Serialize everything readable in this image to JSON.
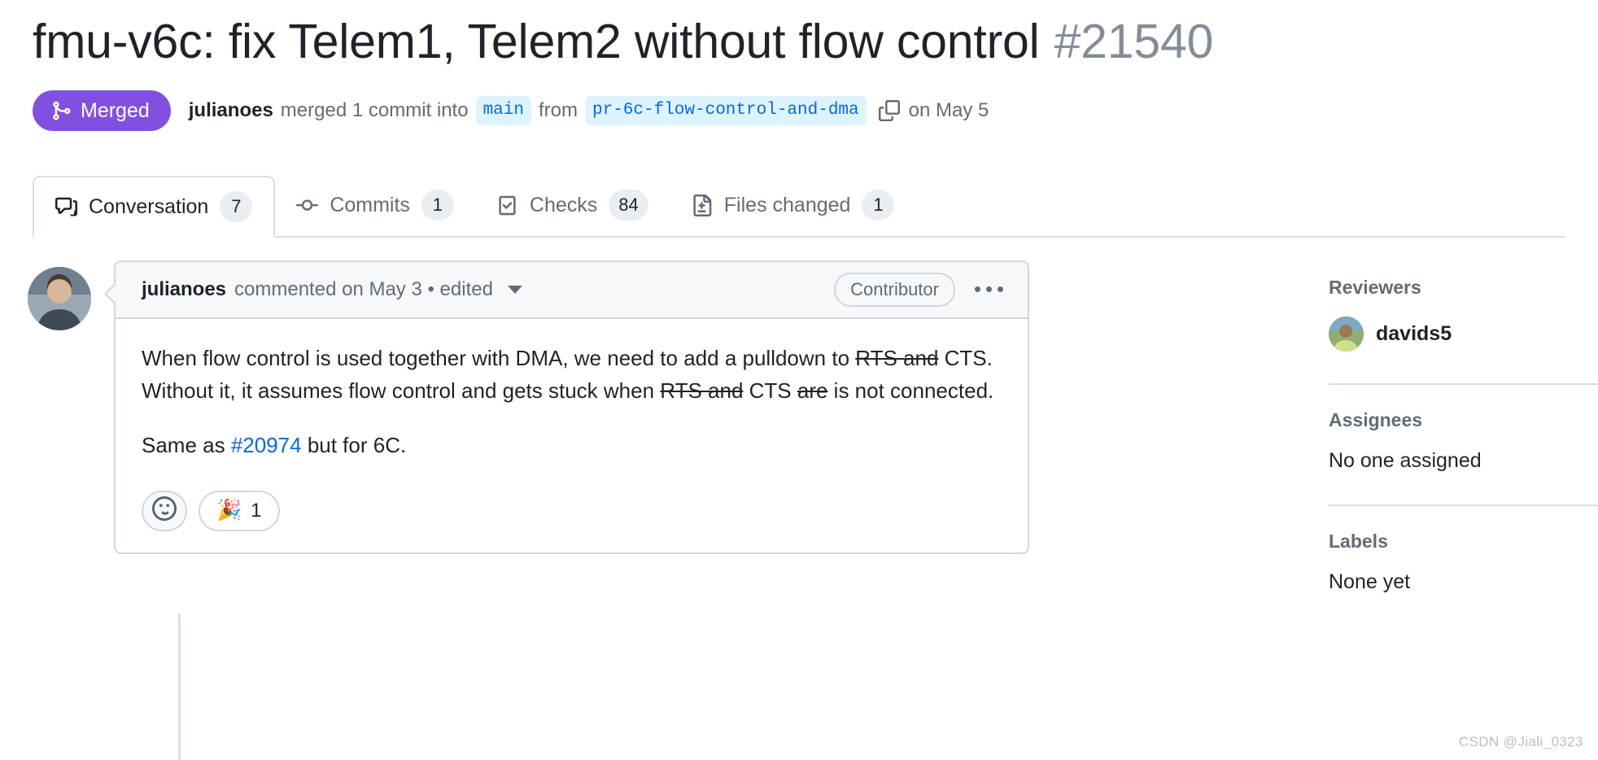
{
  "header": {
    "title": "fmu-v6c: fix Telem1, Telem2 without flow control",
    "number": "#21540",
    "state_label": "Merged",
    "state_color": "#8250df",
    "actor": "julianoes",
    "merged_text": "merged 1 commit into",
    "base_branch": "main",
    "from_text": "from",
    "head_branch": "pr-6c-flow-control-and-dma",
    "merged_date": "on May 5",
    "copy_icon": "copy-icon",
    "merge_icon": "git-merge-icon"
  },
  "tabs": [
    {
      "label": "Conversation",
      "count": "7",
      "icon": "comment-discussion-icon",
      "active": true
    },
    {
      "label": "Commits",
      "count": "1",
      "icon": "git-commit-icon",
      "active": false
    },
    {
      "label": "Checks",
      "count": "84",
      "icon": "checklist-icon",
      "active": false
    },
    {
      "label": "Files changed",
      "count": "1",
      "icon": "file-diff-icon",
      "active": false
    }
  ],
  "comment": {
    "author": "julianoes",
    "meta": "commented on May 3 • edited",
    "role_badge": "Contributor",
    "menu_icon": "kebab-horizontal-icon",
    "caret_icon": "chevron-down-icon",
    "paragraph1": {
      "part1": "When flow control is used together with DMA, we need to add a pulldown to ",
      "strike1": "RTS and",
      "part2": " CTS. Without it, it assumes flow control and gets stuck when ",
      "strike2": "RTS and",
      "part3": " CTS ",
      "strike3": "are",
      "part4": " is not connected."
    },
    "paragraph2": {
      "prefix": "Same as ",
      "link": "#20974",
      "suffix": " but for 6C."
    },
    "reactions": {
      "add_icon": "smiley-icon",
      "items": [
        {
          "emoji": "🎉",
          "name": "tada-reaction",
          "count": "1"
        }
      ]
    }
  },
  "sidebar": {
    "reviewers": {
      "heading": "Reviewers",
      "people": [
        {
          "name": "davids5"
        }
      ]
    },
    "assignees": {
      "heading": "Assignees",
      "value": "No one assigned"
    },
    "labels": {
      "heading": "Labels",
      "value": "None yet"
    }
  },
  "watermark": "CSDN @Jiali_0323"
}
